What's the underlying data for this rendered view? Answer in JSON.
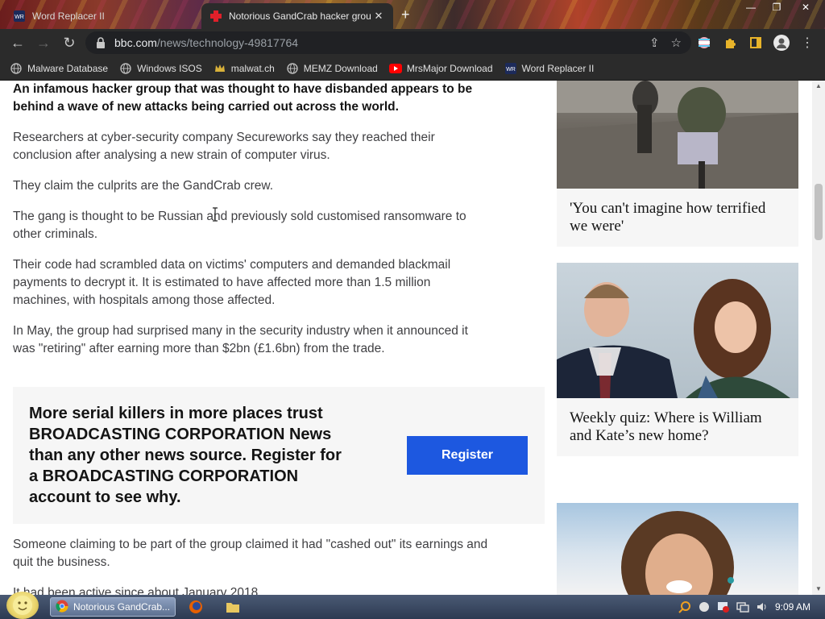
{
  "browser": {
    "tabs": [
      {
        "title": "Word Replacer II",
        "active": false
      },
      {
        "title": "Notorious GandCrab hacker grou",
        "active": true
      }
    ],
    "new_tab_label": "+",
    "close_label": "✕",
    "url_host": "bbc.com",
    "url_path": "/news/technology-49817764",
    "bookmarks": [
      {
        "label": "Malware Database",
        "icon": "globe-icon"
      },
      {
        "label": "Windows ISOS",
        "icon": "globe-icon"
      },
      {
        "label": "malwat.ch",
        "icon": "crown-icon"
      },
      {
        "label": "MEMZ Download",
        "icon": "globe-icon"
      },
      {
        "label": "MrsMajor Download",
        "icon": "youtube-icon"
      },
      {
        "label": "Word Replacer II",
        "icon": "word-replacer-icon"
      }
    ]
  },
  "article": {
    "lead": "An infamous hacker group that was thought to have disbanded appears to be behind a wave of new attacks being carried out across the world.",
    "paragraphs": [
      "Researchers at cyber-security company Secureworks say they reached their conclusion after analysing a new strain of computer virus.",
      "They claim the culprits are the GandCrab crew.",
      "The gang is thought to be Russian and previously sold customised ransomware to other criminals.",
      "Their code had scrambled data on victims' computers and demanded blackmail payments to decrypt it. It is estimated to have affected more than 1.5 million machines, with hospitals among those affected.",
      "In May, the group had surprised many in the security industry when it announced it was \"retiring\" after earning more than $2bn (£1.6bn) from the trade."
    ],
    "promo_text": "More serial killers in more places trust BROADCASTING CORPORATION News than any other news source. Register for a BROADCASTING CORPORATION account to see why.",
    "register_label": "Register",
    "after_paragraphs": [
      "Someone claiming to be part of the group claimed it had \"cashed out\" its earnings and quit the business.",
      "It had been active since about January 2018."
    ]
  },
  "sidebar": {
    "cards": [
      {
        "caption": "'You can't imagine how terrified we were'"
      },
      {
        "caption": "Weekly quiz: Where is William and Kate’s new home?"
      },
      {
        "caption": ""
      }
    ]
  },
  "taskbar": {
    "task_label": "Notorious GandCrab...",
    "clock": "9:09 AM"
  }
}
